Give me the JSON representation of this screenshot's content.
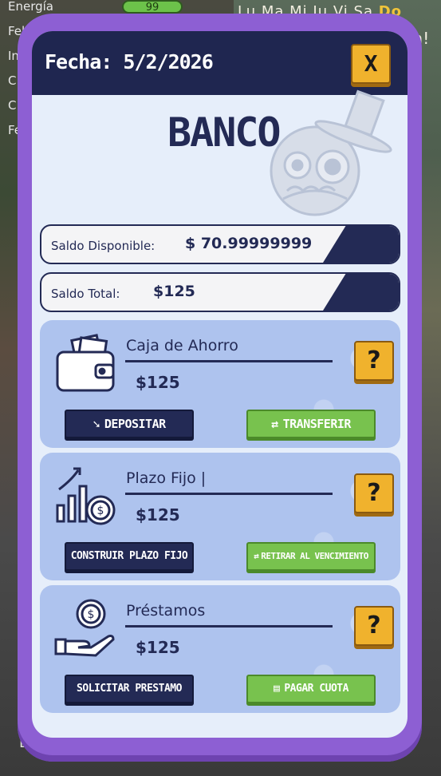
{
  "background": {
    "stats": [
      "Energía",
      "Feli",
      "In",
      "C",
      "C",
      "Fe"
    ],
    "energy_value": "99",
    "days": [
      "Lu",
      "Ma",
      "Mi",
      "Ju",
      "Vi",
      "Sa"
    ],
    "current_day": "Do",
    "bang": "a!",
    "bottom_letter": "D"
  },
  "header": {
    "date": "Fecha: 5/2/2026",
    "close_label": "X"
  },
  "bank": {
    "title": "BANCO"
  },
  "balances": {
    "available_label": "Saldo Disponible:",
    "available_value": "$ 70.99999999",
    "total_label": "Saldo Total:",
    "total_value": "$125"
  },
  "cards": [
    {
      "title": "Caja de Ahorro",
      "amount": "$125",
      "help": "?",
      "left_button": "DEPOSITAR",
      "right_button": "TRANSFERIR"
    },
    {
      "title": "Plazo Fijo |",
      "amount": "$125",
      "help": "?",
      "left_button": "CONSTRUIR PLAZO FIJO",
      "right_button": "RETIRAR AL VENCIMIENTO"
    },
    {
      "title": "Préstamos",
      "amount": "$125",
      "help": "?",
      "left_button": "SOLICITAR PRESTAMO",
      "right_button": "PAGAR CUOTA"
    }
  ],
  "colors": {
    "navy": "#232a55",
    "purple": "#8d5fd3",
    "card": "#aec3ee",
    "gold": "#f0b22d",
    "green": "#78c24e"
  }
}
